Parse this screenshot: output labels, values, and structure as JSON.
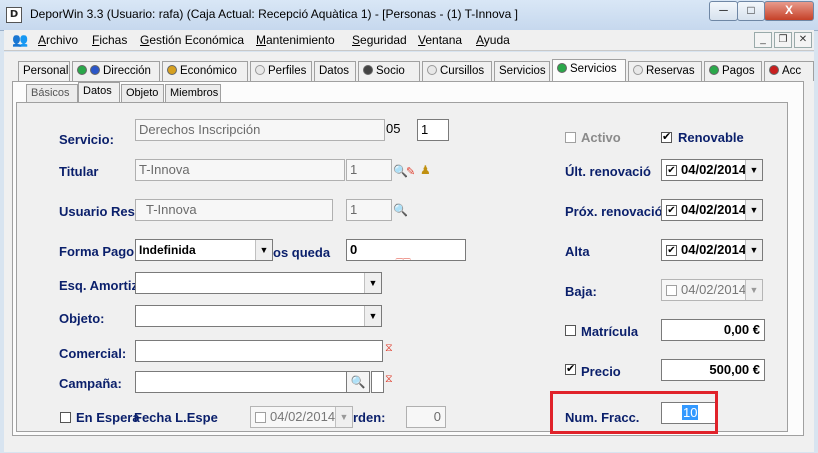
{
  "window": {
    "title": "DeporWin 3.3  (Usuario: rafa)  (Caja Actual: Recepció Aquàtica 1) - [Personas - (1) T-Innova ]",
    "app_letter": "D",
    "minimize": "─",
    "maximize": "□",
    "close": "X"
  },
  "menu": {
    "items": [
      {
        "prefix": "",
        "accel": "A",
        "rest": "rchivo"
      },
      {
        "prefix": "",
        "accel": "F",
        "rest": "ichas"
      },
      {
        "prefix": "",
        "accel": "G",
        "rest": "estión Económica"
      },
      {
        "prefix": "",
        "accel": "M",
        "rest": "antenimiento"
      },
      {
        "prefix": "",
        "accel": "S",
        "rest": "eguridad"
      },
      {
        "prefix": "",
        "accel": "V",
        "rest": "entana"
      },
      {
        "prefix": "",
        "accel": "A",
        "rest": "yuda"
      }
    ],
    "mdi_min": "_",
    "mdi_restore": "❐",
    "mdi_close": "✕"
  },
  "tabs": [
    "Personal",
    "Dirección",
    "Económico",
    "Perfiles",
    "Datos",
    "Socio",
    "Cursillos",
    "Servicios",
    "Servicios",
    "Reservas",
    "Pagos",
    "Acc"
  ],
  "subtabs": [
    "Básicos",
    "Datos",
    "Objeto",
    "Miembros"
  ],
  "form": {
    "servicio_label": "Servicio:",
    "servicio_value": "Derechos Inscripción",
    "servicio_code": "05",
    "servicio_qty": "1",
    "titular_label": "Titular",
    "titular_value": "T-Innova",
    "titular_num": "1",
    "usuario_label": "Usuario Res",
    "usuario_value": "T-Innova",
    "usuario_num": "1",
    "forma_pago_label": "Forma Pago",
    "forma_pago_value": "Indefinida",
    "plazos_label": "os queda",
    "plazos_value": "0",
    "esq_label": "Esq. Amortiz",
    "objeto_label": "Objeto:",
    "comercial_label": "Comercial:",
    "campana_label": "Campaña:",
    "en_espera_label": "En Espera",
    "fecha_espera_label": "Fecha L.Espe",
    "fecha_espera_value": "04/02/2014",
    "orden_label": "rden:",
    "orden_value": "0",
    "activo_label": "Activo",
    "renovable_label": "Renovable",
    "ult_renov_label": "Últ. renovació",
    "ult_renov_value": "04/02/2014",
    "prox_renov_label": "Próx. renovació",
    "prox_renov_value": "04/02/2014",
    "alta_label": "Alta",
    "alta_value": "04/02/2014",
    "baja_label": "Baja:",
    "baja_value": "04/02/2014",
    "matricula_label": "Matrícula",
    "matricula_value": "0,00 €",
    "precio_label": "Precio",
    "precio_value": "500,00 €",
    "num_fracc_label": "Num. Fracc.",
    "num_fracc_value": "10"
  }
}
